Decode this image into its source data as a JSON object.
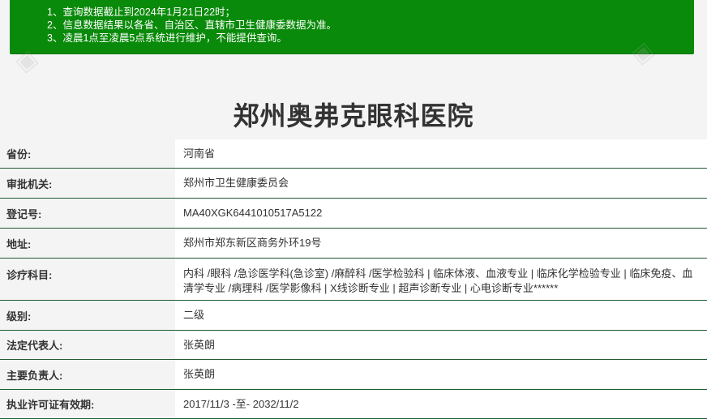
{
  "notice": {
    "lines": [
      "1、查询数据截止到2024年1月21日22时；",
      "2、信息数据结果以各省、自治区、直辖市卫生健康委数据为准。",
      "3、凌晨1点至凌晨5点系统进行维护，不能提供查询。"
    ]
  },
  "hospital": {
    "name": "郑州奥弗克眼科医院"
  },
  "details": [
    {
      "label": "省份:",
      "value": "河南省"
    },
    {
      "label": "审批机关:",
      "value": "郑州市卫生健康委员会"
    },
    {
      "label": "登记号:",
      "value": "MA40XGK6441010517A5122"
    },
    {
      "label": "地址:",
      "value": "郑州市郑东新区商务外环19号"
    },
    {
      "label": "诊疗科目:",
      "value": "内科 /眼科 /急诊医学科(急诊室) /麻醉科 /医学检验科 | 临床体液、血液专业 | 临床化学检验专业 | 临床免疫、血清学专业 /病理科 /医学影像科 | X线诊断专业 | 超声诊断专业 | 心电诊断专业******"
    },
    {
      "label": "级别:",
      "value": "二级"
    },
    {
      "label": "法定代表人:",
      "value": "张英朗"
    },
    {
      "label": "主要负责人:",
      "value": "张英朗"
    },
    {
      "label": "执业许可证有效期:",
      "value": "2017/11/3 -至- 2032/11/2"
    }
  ],
  "colors": {
    "notice_bg": "#0a8a0a",
    "row_border": "#1f5a2e"
  }
}
